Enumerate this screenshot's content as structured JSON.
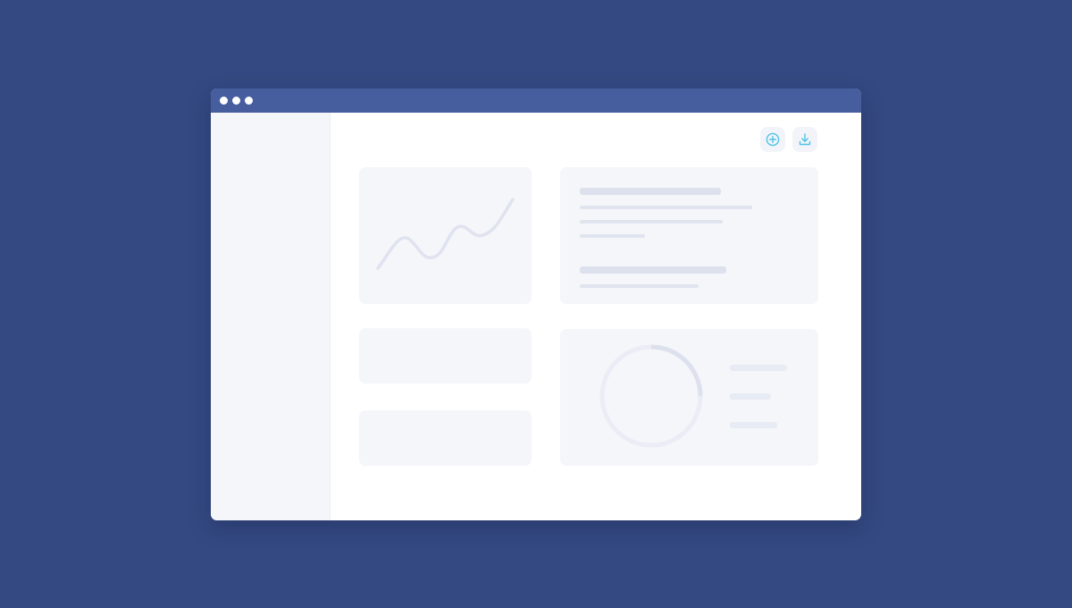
{
  "colors": {
    "background": "#344981",
    "titlebar": "#465d9e",
    "accent_icon": "#4fc3e6",
    "card": "#f5f6fa",
    "line": "#dfe3ef"
  },
  "window": {
    "controls": [
      "dot",
      "dot",
      "dot"
    ]
  },
  "toolbar": {
    "icons": [
      "plus-circle-icon",
      "download-icon"
    ]
  },
  "donut": {
    "progress": 0.25
  }
}
